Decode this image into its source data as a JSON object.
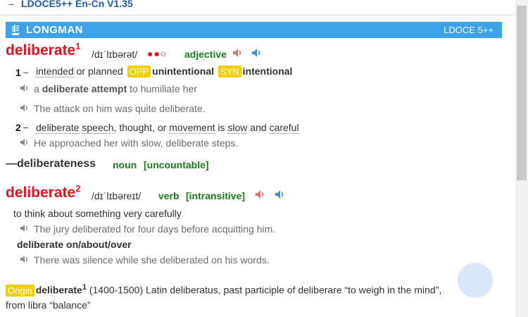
{
  "header": {
    "collapse_symbol": "−",
    "dict_name": "LDOCE5++ En-Cn V1.35"
  },
  "banner": {
    "title": "LONGMAN",
    "right": "LDOCE 5++"
  },
  "entry1": {
    "headword": "deliberate",
    "hom": "1",
    "pron": "/dɪˈlɪbərət/",
    "freq": "●●○",
    "pos": "adjective",
    "senses": [
      {
        "num": "1",
        "def_a": "intended",
        "def_b": " or planned ",
        "opp_tag": "OPP",
        "opp": "unintentional",
        "syn_tag": "SYN",
        "syn": "intentional",
        "ex1_a": "a ",
        "ex1_b": "deliberate attempt",
        "ex1_c": " to humiliate her",
        "ex2": "The attack on him was quite deliberate."
      },
      {
        "num": "2",
        "d1": "deliberate",
        "d2": " ",
        "d3": "speech",
        "d4": ", thought, or ",
        "d5": "movement",
        "d6": " is ",
        "d7": "slow",
        "d8": " and ",
        "d9": "careful",
        "ex1": "He approached her with slow, deliberate steps."
      }
    ],
    "runon": {
      "word": "—deliberateness",
      "pos": "noun",
      "gram": "[uncountable]"
    }
  },
  "entry2": {
    "headword": "deliberate",
    "hom": "2",
    "pron": "/dɪˈlɪbəreɪt/",
    "pos": "verb",
    "gram": "[intransitive]",
    "def": "to think about something very carefully",
    "ex1": "The jury deliberated for four days before acquitting him.",
    "phrase": "deliberate on/about/over",
    "ex2": "There was silence while she deliberated on his words."
  },
  "origin": {
    "tag": "Origin",
    "word": "deliberate",
    "hom": "1",
    "text": " (1400-1500) Latin deliberatus, past participle of deliberare “to weigh in the mind”,",
    "text2": "from libra “balance”"
  },
  "colors": {
    "banner": "#3da2e8",
    "headword": "#e0141e",
    "pos": "#1a7d1a",
    "tag": "#f2cf00",
    "speaker_uk": "#e86c6c",
    "speaker_us": "#3d8fd8"
  }
}
